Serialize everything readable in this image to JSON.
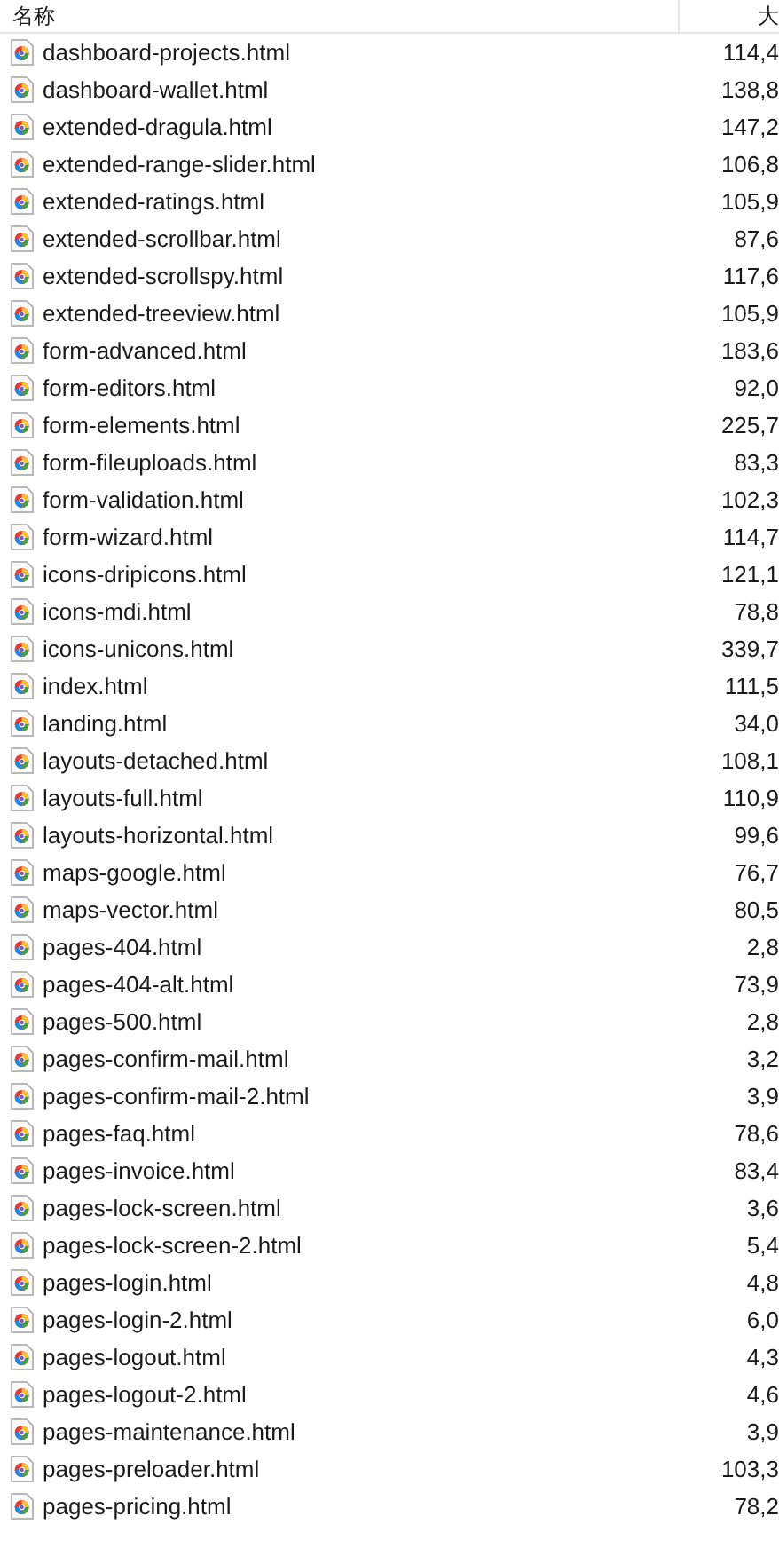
{
  "columns": [
    "名称",
    "大"
  ],
  "files": [
    {
      "name": "dashboard-projects.html",
      "size": "114,4"
    },
    {
      "name": "dashboard-wallet.html",
      "size": "138,8"
    },
    {
      "name": "extended-dragula.html",
      "size": "147,2"
    },
    {
      "name": "extended-range-slider.html",
      "size": "106,8"
    },
    {
      "name": "extended-ratings.html",
      "size": "105,9"
    },
    {
      "name": "extended-scrollbar.html",
      "size": "87,6"
    },
    {
      "name": "extended-scrollspy.html",
      "size": "117,6"
    },
    {
      "name": "extended-treeview.html",
      "size": "105,9"
    },
    {
      "name": "form-advanced.html",
      "size": "183,6"
    },
    {
      "name": "form-editors.html",
      "size": "92,0"
    },
    {
      "name": "form-elements.html",
      "size": "225,7"
    },
    {
      "name": "form-fileuploads.html",
      "size": "83,3"
    },
    {
      "name": "form-validation.html",
      "size": "102,3"
    },
    {
      "name": "form-wizard.html",
      "size": "114,7"
    },
    {
      "name": "icons-dripicons.html",
      "size": "121,1"
    },
    {
      "name": "icons-mdi.html",
      "size": "78,8"
    },
    {
      "name": "icons-unicons.html",
      "size": "339,7"
    },
    {
      "name": "index.html",
      "size": "111,5"
    },
    {
      "name": "landing.html",
      "size": "34,0"
    },
    {
      "name": "layouts-detached.html",
      "size": "108,1"
    },
    {
      "name": "layouts-full.html",
      "size": "110,9"
    },
    {
      "name": "layouts-horizontal.html",
      "size": "99,6"
    },
    {
      "name": "maps-google.html",
      "size": "76,7"
    },
    {
      "name": "maps-vector.html",
      "size": "80,5"
    },
    {
      "name": "pages-404.html",
      "size": "2,8"
    },
    {
      "name": "pages-404-alt.html",
      "size": "73,9"
    },
    {
      "name": "pages-500.html",
      "size": "2,8"
    },
    {
      "name": "pages-confirm-mail.html",
      "size": "3,2"
    },
    {
      "name": "pages-confirm-mail-2.html",
      "size": "3,9"
    },
    {
      "name": "pages-faq.html",
      "size": "78,6"
    },
    {
      "name": "pages-invoice.html",
      "size": "83,4"
    },
    {
      "name": "pages-lock-screen.html",
      "size": "3,6"
    },
    {
      "name": "pages-lock-screen-2.html",
      "size": "5,4"
    },
    {
      "name": "pages-login.html",
      "size": "4,8"
    },
    {
      "name": "pages-login-2.html",
      "size": "6,0"
    },
    {
      "name": "pages-logout.html",
      "size": "4,3"
    },
    {
      "name": "pages-logout-2.html",
      "size": "4,6"
    },
    {
      "name": "pages-maintenance.html",
      "size": "3,9"
    },
    {
      "name": "pages-preloader.html",
      "size": "103,3"
    },
    {
      "name": "pages-pricing.html",
      "size": "78,2"
    }
  ]
}
